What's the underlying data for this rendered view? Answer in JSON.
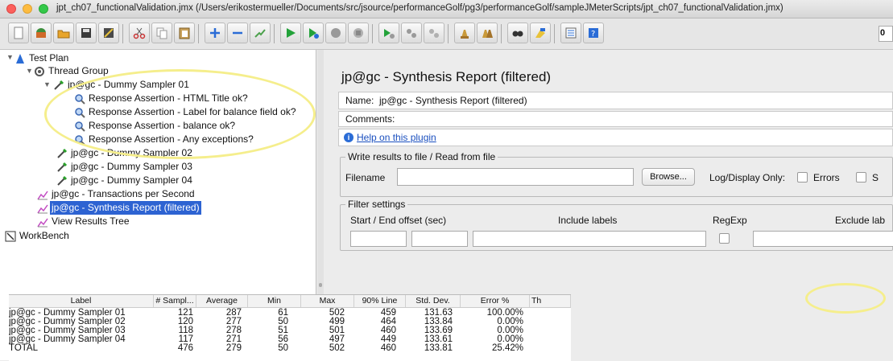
{
  "window": {
    "title": "jpt_ch07_functionalValidation.jmx (/Users/erikostermueller/Documents/src/jsource/performanceGolf/pg3/performanceGolf/sampleJMeterScripts/jpt_ch07_functionalValidation.jmx)",
    "traffic_colors": [
      "#fc605c",
      "#fdbc40",
      "#34c84a"
    ]
  },
  "toolbar": {
    "counter_text": "0"
  },
  "tree": {
    "test_plan": "Test Plan",
    "thread_group": "Thread Group",
    "sampler_01": "jp@gc - Dummy Sampler 01",
    "assert_title": "Response Assertion - HTML Title ok?",
    "assert_label": "Response Assertion - Label for balance field ok?",
    "assert_balance": "Response Assertion - balance ok?",
    "assert_exceptions": "Response Assertion - Any exceptions?",
    "sampler_02": "jp@gc - Dummy Sampler 02",
    "sampler_03": "jp@gc - Dummy Sampler 03",
    "sampler_04": "jp@gc - Dummy Sampler 04",
    "tps": "jp@gc - Transactions per Second",
    "synthesis": "jp@gc - Synthesis Report (filtered)",
    "view_results": "View Results Tree",
    "workbench": "WorkBench"
  },
  "panel": {
    "title": "jp@gc - Synthesis Report (filtered)",
    "name_label": "Name:",
    "name_value": "jp@gc - Synthesis Report (filtered)",
    "comments_label": "Comments:",
    "help_link": "Help on this plugin",
    "write_legend": "Write results to file / Read from file",
    "filename_label": "Filename",
    "browse_button": "Browse...",
    "log_display_label": "Log/Display Only:",
    "errors_label": "Errors",
    "successes_label": "S",
    "filter_legend": "Filter settings",
    "offset_label": "Start / End offset (sec)",
    "include_label": "Include labels",
    "regexp_label": "RegExp",
    "exclude_label": "Exclude lab"
  },
  "table": {
    "headers": [
      "Label",
      "# Sampl...",
      "Average",
      "Min",
      "Max",
      "90% Line",
      "Std. Dev.",
      "Error %",
      "Th"
    ],
    "rows": [
      [
        "jp@gc - Dummy Sampler 01",
        "121",
        "287",
        "61",
        "502",
        "459",
        "131.63",
        "100.00%"
      ],
      [
        "jp@gc - Dummy Sampler 02",
        "120",
        "277",
        "50",
        "499",
        "464",
        "133.84",
        "0.00%"
      ],
      [
        "jp@gc - Dummy Sampler 03",
        "118",
        "278",
        "51",
        "501",
        "460",
        "133.69",
        "0.00%"
      ],
      [
        "jp@gc - Dummy Sampler 04",
        "117",
        "271",
        "56",
        "497",
        "449",
        "133.61",
        "0.00%"
      ],
      [
        "TOTAL",
        "476",
        "279",
        "50",
        "502",
        "460",
        "133.81",
        "25.42%"
      ]
    ]
  },
  "colors": {
    "selection": "#2d63d2",
    "highlight": "#f5ee8c",
    "link": "#1a4fbf"
  }
}
